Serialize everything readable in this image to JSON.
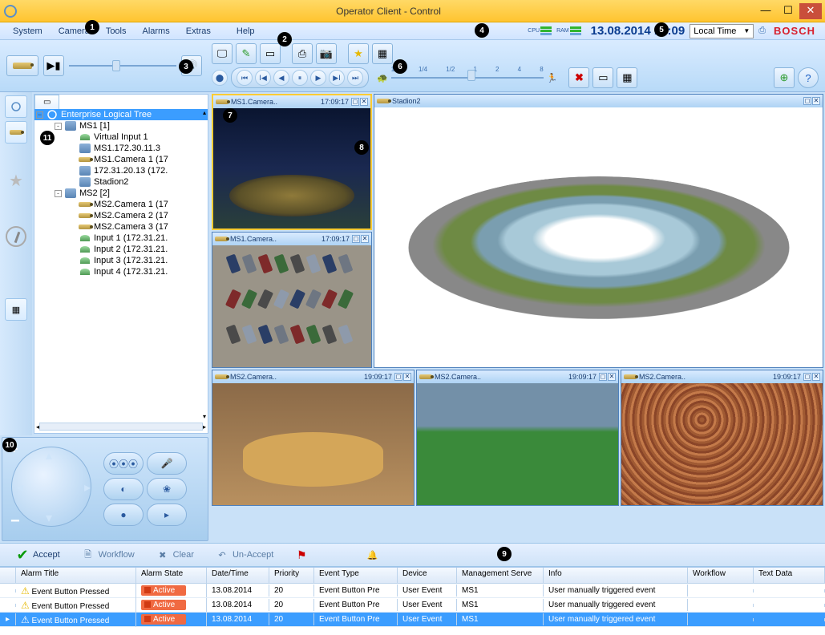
{
  "title": "Operator Client - Control",
  "menu": {
    "system": "System",
    "camera": "Camera",
    "tools": "Tools",
    "alarms": "Alarms",
    "extras": "Extras",
    "help": "Help"
  },
  "datetime": "13.08.2014 17:09",
  "timezone": "Local Time",
  "brand": "BOSCH",
  "resources": {
    "cpu": "CPU",
    "ram": "RAM"
  },
  "speed_ticks": [
    "1/8",
    "1/4",
    "1/2",
    "1",
    "2",
    "4",
    "8"
  ],
  "tree": {
    "root": "Enterprise Logical Tree",
    "items": [
      {
        "label": "MS1 [1]",
        "depth": 1,
        "exp": "-",
        "icon": "srv"
      },
      {
        "label": "Virtual Input 1",
        "depth": 2,
        "icon": "inp"
      },
      {
        "label": "MS1.172.30.11.3",
        "depth": 2,
        "icon": "srv"
      },
      {
        "label": "MS1.Camera 1 (17",
        "depth": 2,
        "icon": "cam"
      },
      {
        "label": "172.31.20.13 (172.",
        "depth": 2,
        "icon": "srv"
      },
      {
        "label": "Stadion2",
        "depth": 2,
        "icon": "srv"
      },
      {
        "label": "MS2 [2]",
        "depth": 1,
        "exp": "-",
        "icon": "srv"
      },
      {
        "label": "MS2.Camera 1 (17",
        "depth": 2,
        "icon": "cam"
      },
      {
        "label": "MS2.Camera 2 (17",
        "depth": 2,
        "icon": "cam"
      },
      {
        "label": "MS2.Camera 3 (17",
        "depth": 2,
        "icon": "cam"
      },
      {
        "label": "Input 1 (172.31.21.",
        "depth": 2,
        "icon": "inp"
      },
      {
        "label": "Input 2 (172.31.21.",
        "depth": 2,
        "icon": "inp"
      },
      {
        "label": "Input 3 (172.31.21.",
        "depth": 2,
        "icon": "inp"
      },
      {
        "label": "Input 4 (172.31.21.",
        "depth": 2,
        "icon": "inp"
      }
    ]
  },
  "video_tiles": [
    {
      "title": "MS1.Camera..",
      "time": "17:09:17",
      "scene": "night",
      "selected": true
    },
    {
      "title": "Stadion2",
      "time": "",
      "scene": "white",
      "big": true
    },
    {
      "title": "MS1.Camera..",
      "time": "17:09:17",
      "scene": "parking"
    },
    {
      "title": "MS2.Camera..",
      "time": "19:09:17",
      "scene": "arena"
    },
    {
      "title": "MS2.Camera..",
      "time": "19:09:17",
      "scene": "field"
    },
    {
      "title": "MS2.Camera..",
      "time": "19:09:17",
      "scene": "crowd"
    }
  ],
  "alarm_buttons": {
    "accept": "Accept",
    "workflow": "Workflow",
    "clear": "Clear",
    "unaccept": "Un-Accept"
  },
  "alarm_cols": {
    "title": "Alarm Title",
    "state": "Alarm State",
    "date": "Date/Time",
    "pri": "Priority",
    "evt": "Event Type",
    "dev": "Device",
    "ms": "Management Serve",
    "info": "Info",
    "wf": "Workflow",
    "td": "Text Data"
  },
  "alarms": [
    {
      "title": "Event Button Pressed",
      "state": "Active",
      "date": "13.08.2014",
      "pri": "20",
      "evt": "Event Button Pre",
      "dev": "User Event",
      "ms": "MS1",
      "info": "User manually triggered event",
      "sel": false
    },
    {
      "title": "Event Button Pressed",
      "state": "Active",
      "date": "13.08.2014",
      "pri": "20",
      "evt": "Event Button Pre",
      "dev": "User Event",
      "ms": "MS1",
      "info": "User manually triggered event",
      "sel": false
    },
    {
      "title": "Event Button Pressed",
      "state": "Active",
      "date": "13.08.2014",
      "pri": "20",
      "evt": "Event Button Pre",
      "dev": "User Event",
      "ms": "MS1",
      "info": "User manually triggered event",
      "sel": true
    }
  ],
  "callouts": {
    "1": "1",
    "2": "2",
    "3": "3",
    "4": "4",
    "5": "5",
    "6": "6",
    "7": "7",
    "8": "8",
    "9": "9",
    "10": "10",
    "11": "11"
  }
}
